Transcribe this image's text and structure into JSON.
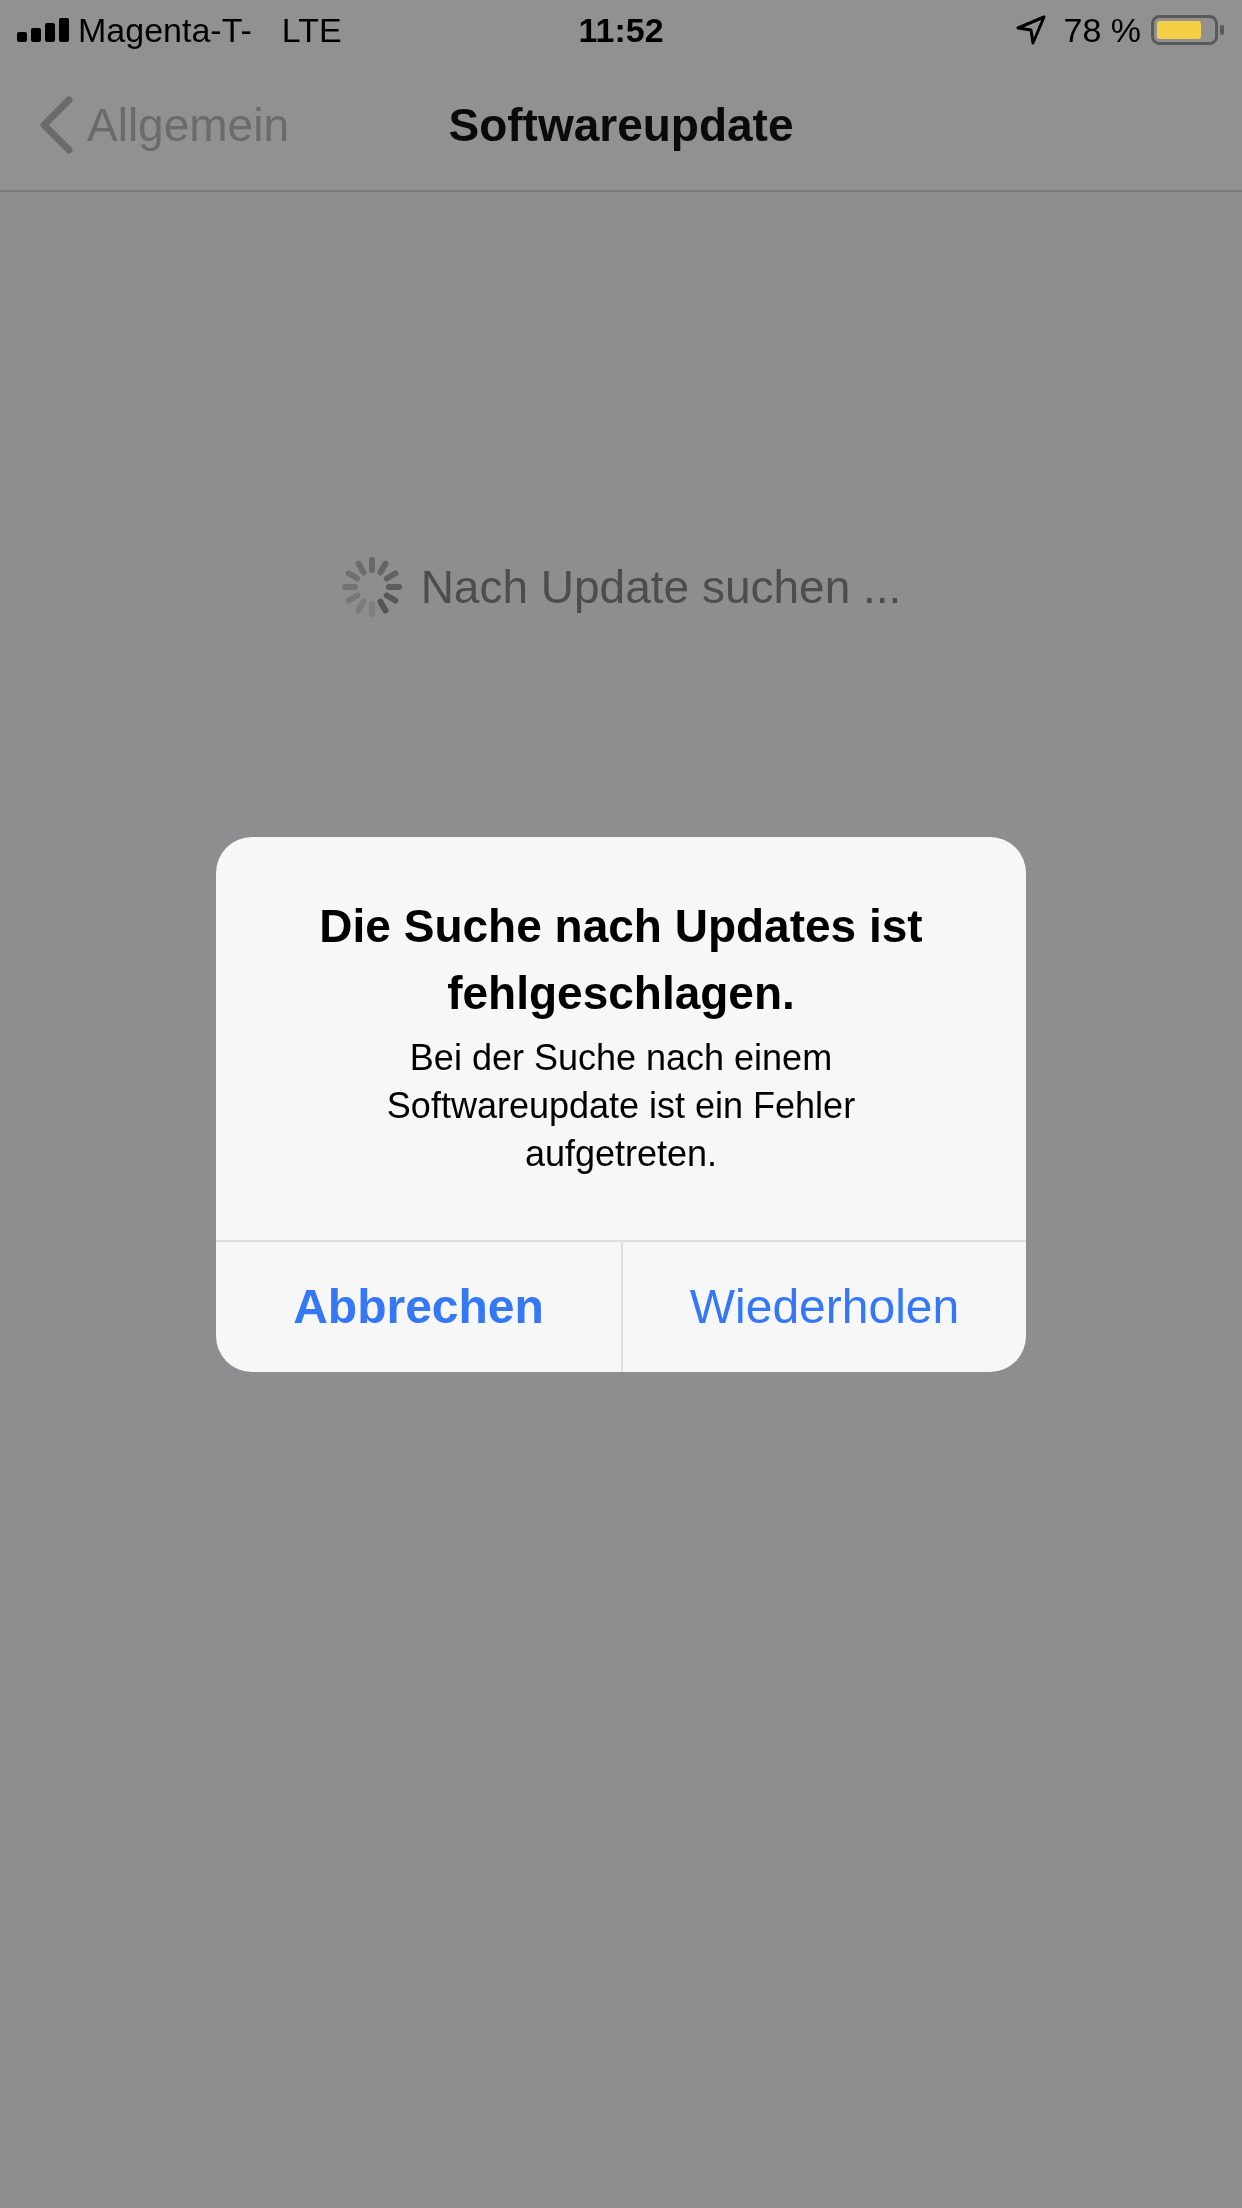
{
  "status_bar": {
    "carrier": "Magenta-T-",
    "network": "LTE",
    "time": "11:52",
    "battery": "78 %"
  },
  "nav_bar": {
    "back_label": "Allgemein",
    "title": "Softwareupdate"
  },
  "content": {
    "status_text": "Nach Update suchen ..."
  },
  "alert": {
    "title": "Die Suche nach Updates ist fehlgeschlagen.",
    "message": "Bei der Suche nach einem Softwareupdate ist ein Fehler aufgetreten.",
    "buttons": [
      {
        "label": "Abbrechen",
        "kind": "preferred"
      },
      {
        "label": "Wiederholen",
        "kind": "default"
      }
    ]
  }
}
